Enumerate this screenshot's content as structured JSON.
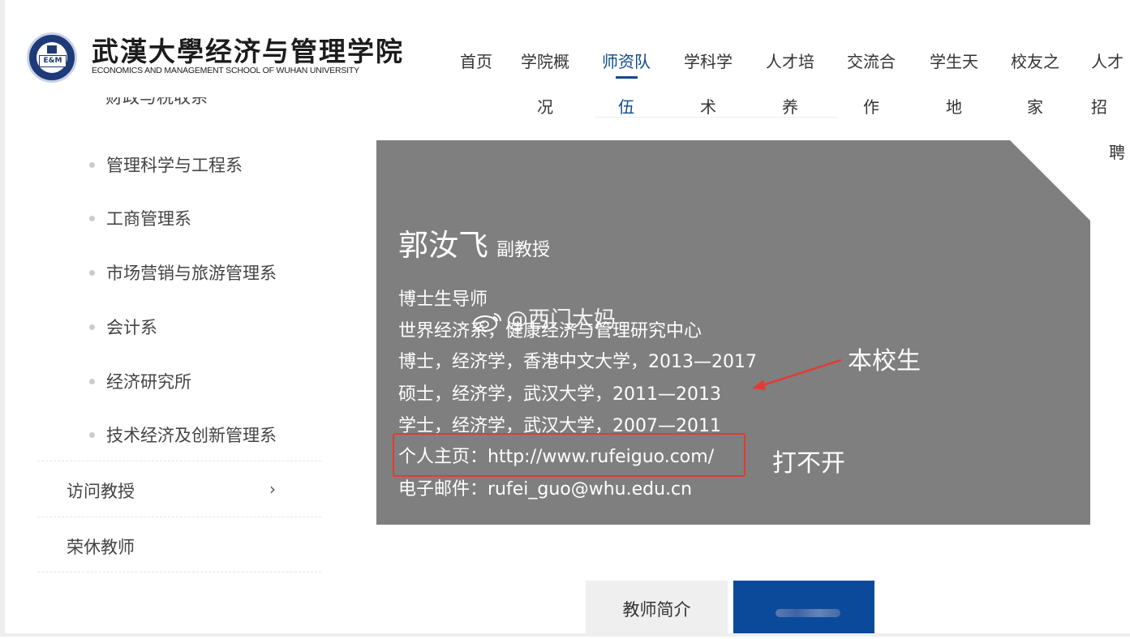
{
  "header": {
    "logo_cn": "武漢大學经济与管理学院",
    "logo_en": "ECONOMICS AND MANAGEMENT SCHOOL OF WUHAN UNIVERSITY",
    "logo_badge": "E&M",
    "nav": [
      {
        "line1": "首页",
        "line2": ""
      },
      {
        "line1": "学院概",
        "line2": "况"
      },
      {
        "line1": "师资队",
        "line2": "伍"
      },
      {
        "line1": "学科学",
        "line2": "术"
      },
      {
        "line1": "人才培",
        "line2": "养"
      },
      {
        "line1": "交流合",
        "line2": "作"
      },
      {
        "line1": "学生天",
        "line2": "地"
      },
      {
        "line1": "校友之",
        "line2": "家"
      },
      {
        "line1": "人才招",
        "line2": "聘"
      }
    ],
    "active_nav": "师资队伍",
    "accent_color": "#0e4a8e"
  },
  "sidebar": {
    "cut_off_item": "财政与税收系",
    "sub_items": [
      "管理科学与工程系",
      "工商管理系",
      "市场营销与旅游管理系",
      "会计系",
      "经济研究所",
      "技术经济及创新管理系"
    ],
    "main_items": [
      {
        "label": "访问教授",
        "icon": "chevron-right-icon"
      },
      {
        "label": "荣休教师"
      }
    ]
  },
  "profile": {
    "name": "郭汝飞",
    "title": "副教授",
    "lines": [
      "博士生导师",
      "世界经济系，健康经济与管理研究中心",
      "博士，经济学，香港中文大学，2013—2017",
      "硕士，经济学，武汉大学，2011—2013",
      "学士，经济学，武汉大学，2007—2011",
      "个人主页：http://www.rufeiguo.com/",
      "电子邮件：rufei_guo@whu.edu.cn"
    ]
  },
  "annotations": {
    "alumni_note": "本校生",
    "broken_link_note": "打不开",
    "highlight_color": "#e23b35"
  },
  "watermark": {
    "text": "@西门大妈",
    "icon": "weibo-icon"
  },
  "tabs": {
    "intro_label": "教师简介"
  }
}
